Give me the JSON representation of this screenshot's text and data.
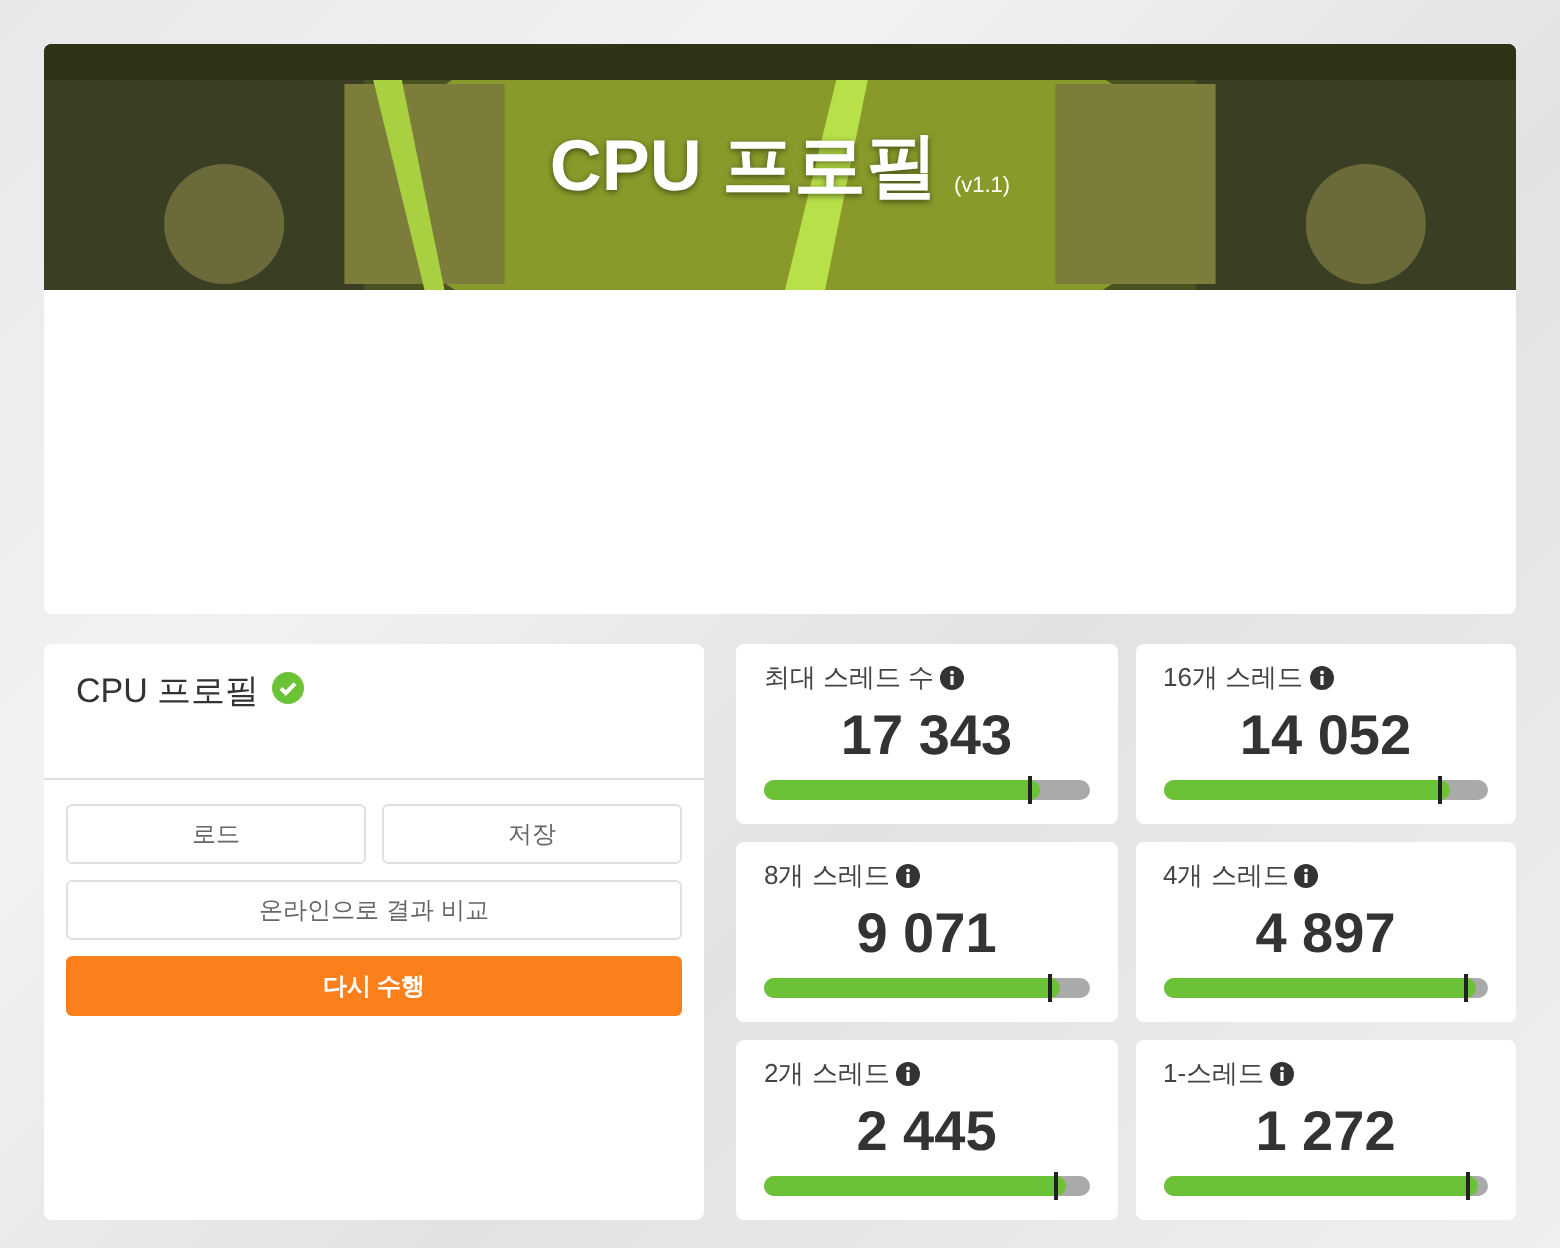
{
  "banner": {
    "title": "CPU 프로필",
    "version": "(v1.1)"
  },
  "profile_panel": {
    "title": "CPU 프로필",
    "verified": true,
    "buttons": [
      {
        "label": "로드",
        "kind": "plain"
      },
      {
        "label": "저장",
        "kind": "plain"
      },
      {
        "label": "온라인으로 결과 비교",
        "kind": "wide"
      },
      {
        "label": "다시 수행",
        "kind": "primary"
      }
    ]
  },
  "scores": [
    {
      "label": "최대 스레드 수",
      "value": "17 343",
      "level": 0.85
    },
    {
      "label": "16개 스레드",
      "value": "14 052",
      "level": 0.88
    },
    {
      "label": "8개 스레드",
      "value": "9 071",
      "level": 0.91
    },
    {
      "label": "4개 스레드",
      "value": "4 897",
      "level": 0.96
    },
    {
      "label": "2개 스레드",
      "value": "2 445",
      "level": 0.93
    },
    {
      "label": "1-스레드",
      "value": "1 272",
      "level": 0.97
    }
  ]
}
